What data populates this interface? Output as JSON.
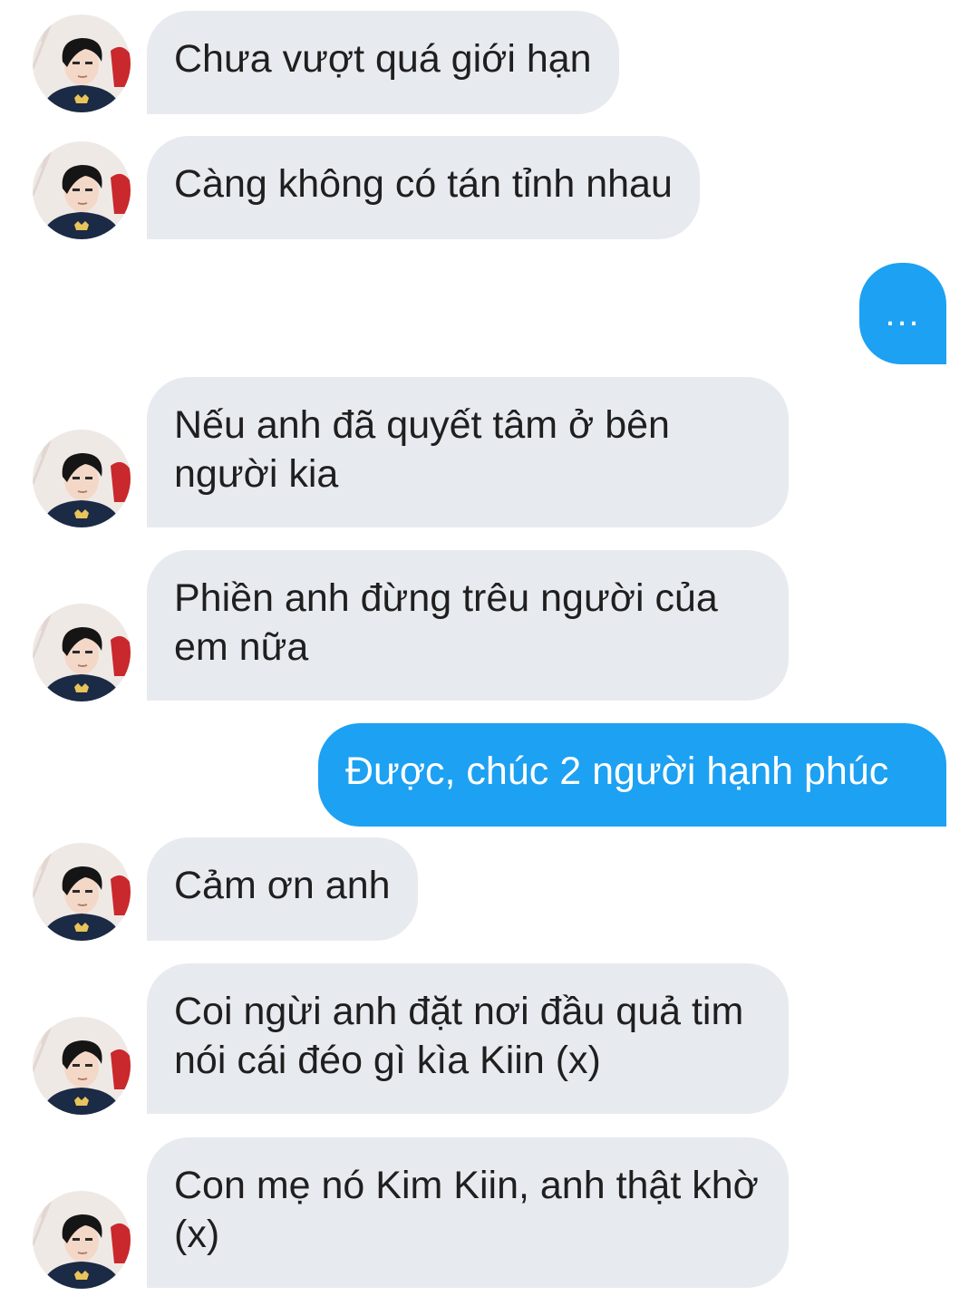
{
  "avatar_icon": "user-avatar-photo",
  "colors": {
    "incoming_bubble": "#e7ebef",
    "outgoing_bubble": "#1da1f2"
  },
  "messages": [
    {
      "side": "in",
      "text": "Chưa vượt quá giới hạn"
    },
    {
      "side": "in",
      "text": "Càng không có tán tỉnh nhau"
    },
    {
      "side": "out",
      "text": "..."
    },
    {
      "side": "in",
      "text": "Nếu anh đã quyết tâm ở bên người kia"
    },
    {
      "side": "in",
      "text": "Phiền anh đừng trêu người của em nữa"
    },
    {
      "side": "out",
      "text": "Được, chúc 2 người hạnh phúc"
    },
    {
      "side": "in",
      "text": "Cảm ơn anh"
    },
    {
      "side": "in",
      "text": "Coi ngừi anh đặt nơi đầu quả tim nói cái đéo gì kìa Kiin (x)"
    },
    {
      "side": "in",
      "text": "Con mẹ nó Kim Kiin, anh thật khờ (x)"
    }
  ]
}
